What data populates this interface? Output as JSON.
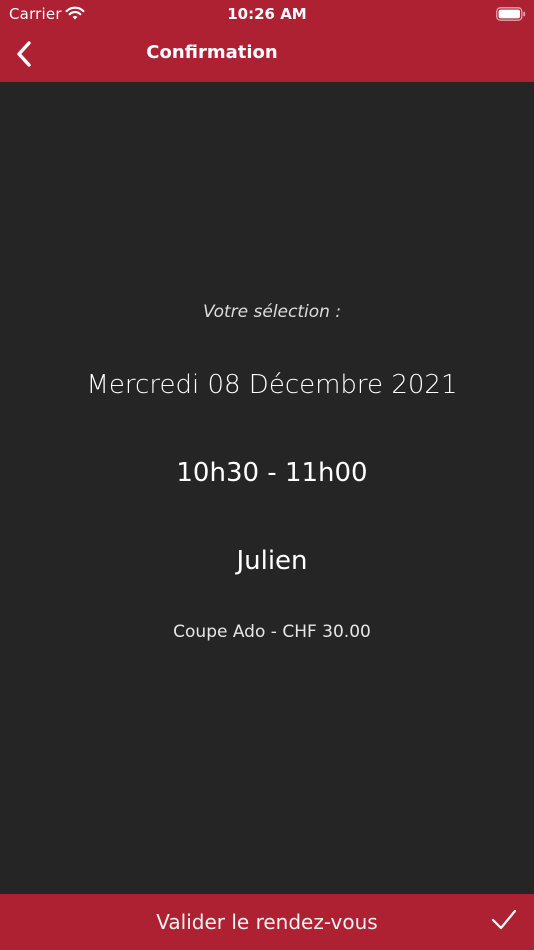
{
  "status_bar": {
    "carrier": "Carrier",
    "time": "10:26 AM",
    "wifi_icon": "wifi-icon",
    "battery_icon": "battery-icon"
  },
  "nav": {
    "title": "Confirmation",
    "back_icon": "chevron-left-icon"
  },
  "selection": {
    "label": "Votre sélection :",
    "date": "Mercredi 08 Décembre 2021",
    "time_slot": "10h30 - 11h00",
    "staff": "Julien",
    "service": "Coupe Ado - CHF 30.00"
  },
  "footer": {
    "validate_label": "Valider le rendez-vous",
    "check_icon": "checkmark-icon"
  },
  "colors": {
    "accent": "#ad2133",
    "background": "#252525",
    "text": "#ffffff"
  }
}
